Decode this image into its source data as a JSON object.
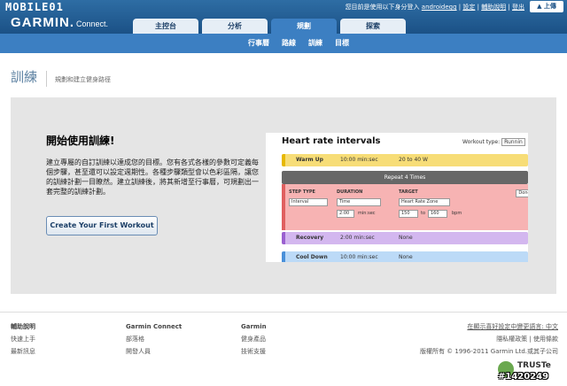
{
  "brand": {
    "watermark_top": "MOBILE01",
    "name": "GARMIN.",
    "sub": "Connect."
  },
  "userbar": {
    "prefix": "您目前是使用以下身分登入",
    "username": "androidegg",
    "settings": "設定",
    "help": "輔助說明",
    "logout": "登出",
    "upload": "上傳"
  },
  "tabs": [
    {
      "label": "主控台"
    },
    {
      "label": "分析"
    },
    {
      "label": "規劃"
    },
    {
      "label": "探索"
    }
  ],
  "subnav": [
    {
      "label": "行事曆"
    },
    {
      "label": "路線"
    },
    {
      "label": "訓練"
    },
    {
      "label": "目標"
    }
  ],
  "page": {
    "title": "訓練",
    "subtitle": "規劃和建立健身路徑"
  },
  "panel": {
    "heading": "開始使用訓練!",
    "body": "建立專屬的自訂訓練以達成您的目標。您有各式各樣的參數可定義每個步驟，甚至還可以設定週期性。各種步驟類型會以色彩區隔，讓您的訓練計劃一目瞭然。建立訓練後，將其新增至行事曆，可規劃出一套完整的訓練計劃。",
    "cta": "Create Your First Workout"
  },
  "preview": {
    "title": "Heart rate intervals",
    "workout_type_label": "Workout type:",
    "workout_type_value": "Runnin",
    "warm_label": "Warm Up",
    "warm_duration": "10:00 min:sec",
    "warm_target": "20 to 40 W",
    "repeat_label": "Repeat 4 Times",
    "step_type_label": "STEP TYPE",
    "duration_label": "DURATION",
    "target_label": "TARGET",
    "step_type_value": "Interval",
    "duration_value": "Time",
    "target_value": "Heart Rate Zone",
    "duration_input": "2:00",
    "duration_unit": "min:sec",
    "target_from": "150",
    "to_word": "to",
    "target_to": "160",
    "target_unit": "bpm",
    "done": "Done",
    "recovery_label": "Recovery",
    "recovery_duration": "2:00 min:sec",
    "recovery_target": "None",
    "cool_label": "Cool Down",
    "cool_duration": "10:00 min:sec",
    "cool_target": "None"
  },
  "footer": {
    "col1": {
      "heading": "輔助說明",
      "links": [
        "快速上手",
        "最新訊息"
      ]
    },
    "col2": {
      "heading": "Garmin Connect",
      "links": [
        "部落格",
        "開發人員"
      ]
    },
    "col3": {
      "heading": "Garmin",
      "links": [
        "健身產品",
        "技術支援"
      ]
    },
    "right1": "在顯示喜好設定中變更語言: 中文",
    "right2": "隱私權政策 | 使用條款",
    "right3": "版權所有 © 1996-2011 Garmin Ltd.或其子公司",
    "truste": "TRUSTe",
    "watermark": "#1420249"
  }
}
